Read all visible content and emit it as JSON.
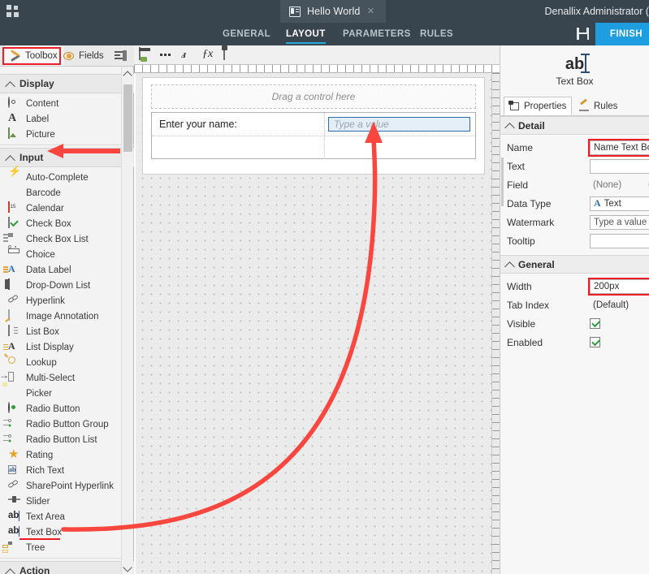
{
  "titlebar": {
    "app_menu_icon": "waffle-icon",
    "document_tab": {
      "title": "Hello World",
      "icon": "form-icon",
      "close": "×"
    },
    "user": "Denallix Administrator ("
  },
  "menubar": {
    "items": [
      {
        "label": "GENERAL",
        "active": false
      },
      {
        "label": "LAYOUT",
        "active": true
      },
      {
        "label": "PARAMETERS",
        "active": false
      },
      {
        "label": "RULES",
        "active": false
      }
    ],
    "save_icon": "save-floppy-icon",
    "finish_label": "FINISH"
  },
  "toolbox_panel": {
    "tabs": [
      {
        "label": "Toolbox",
        "icon": "wrench-icon",
        "selected": true,
        "highlighted": true
      },
      {
        "label": "Fields",
        "icon": "fields-icon",
        "selected": false
      },
      {
        "label": "",
        "icon": "list-view-icon",
        "selected": false
      }
    ],
    "sections": [
      {
        "label": "Display",
        "items": [
          {
            "label": "Content",
            "icon": "at-icon"
          },
          {
            "label": "Label",
            "icon": "letter-a-icon"
          },
          {
            "label": "Picture",
            "icon": "picture-icon"
          }
        ]
      },
      {
        "label": "Input",
        "annotated": true,
        "items": [
          {
            "label": "Auto-Complete",
            "icon": "lightning-icon"
          },
          {
            "label": "Barcode",
            "icon": "barcode-icon"
          },
          {
            "label": "Calendar",
            "icon": "calendar-icon"
          },
          {
            "label": "Check Box",
            "icon": "checkbox-icon"
          },
          {
            "label": "Check Box List",
            "icon": "checkbox-list-icon"
          },
          {
            "label": "Choice",
            "icon": "choice-icon"
          },
          {
            "label": "Data Label",
            "icon": "data-label-icon"
          },
          {
            "label": "Drop-Down List",
            "icon": "dropdown-icon"
          },
          {
            "label": "Hyperlink",
            "icon": "link-icon"
          },
          {
            "label": "Image Annotation",
            "icon": "image-annotation-icon"
          },
          {
            "label": "List Box",
            "icon": "list-box-icon"
          },
          {
            "label": "List Display",
            "icon": "list-display-icon"
          },
          {
            "label": "Lookup",
            "icon": "magnifier-icon"
          },
          {
            "label": "Multi-Select",
            "icon": "multi-select-icon"
          },
          {
            "label": "Picker",
            "icon": "picker-icon"
          },
          {
            "label": "Radio Button",
            "icon": "radio-icon"
          },
          {
            "label": "Radio Button Group",
            "icon": "radio-group-icon"
          },
          {
            "label": "Radio Button List",
            "icon": "radio-list-icon"
          },
          {
            "label": "Rating",
            "icon": "star-icon"
          },
          {
            "label": "Rich Text",
            "icon": "rich-text-icon"
          },
          {
            "label": "SharePoint Hyperlink",
            "icon": "link-icon"
          },
          {
            "label": "Slider",
            "icon": "slider-icon"
          },
          {
            "label": "Text Area",
            "icon": "ab-cursor-icon"
          },
          {
            "label": "Text Box",
            "icon": "ab-cursor-icon",
            "highlighted": true
          },
          {
            "label": "Tree",
            "icon": "tree-icon"
          }
        ]
      },
      {
        "label": "Action",
        "items": []
      }
    ]
  },
  "canvas": {
    "toolbar_icons": [
      "insert-control-icon",
      "more-options-icon",
      "cut-transition-icon",
      "function-icon",
      "paste-icon"
    ],
    "drop_zone_text": "Drag a control here",
    "table": {
      "rows": [
        {
          "left_cell": "Enter your name:",
          "right_cell_control": {
            "type": "text-box",
            "watermark": "Type a value",
            "selected": true
          }
        },
        {
          "left_cell": "",
          "right_cell_control": null
        }
      ]
    }
  },
  "properties_panel": {
    "control_icon": "ab-cursor-icon",
    "control_type": "Text Box",
    "tabs": [
      {
        "label": "Properties",
        "icon": "properties-icon",
        "selected": true
      },
      {
        "label": "Rules",
        "icon": "rules-gavel-icon",
        "selected": false
      }
    ],
    "sections": [
      {
        "label": "Detail",
        "rows": [
          {
            "label": "Name",
            "value": "Name Text Bo,",
            "kind": "text",
            "highlighted": true
          },
          {
            "label": "Text",
            "value": "",
            "kind": "text"
          },
          {
            "label": "Field",
            "value": "(None)",
            "kind": "picker"
          },
          {
            "label": "Data Type",
            "value": "Text",
            "kind": "dropdown"
          },
          {
            "label": "Watermark",
            "value": "Type a value",
            "kind": "text"
          },
          {
            "label": "Tooltip",
            "value": "",
            "kind": "text"
          }
        ]
      },
      {
        "label": "General",
        "rows": [
          {
            "label": "Width",
            "value": "200px",
            "kind": "text",
            "highlighted": true
          },
          {
            "label": "Tab Index",
            "value": "(Default)",
            "kind": "plain"
          },
          {
            "label": "Visible",
            "value": true,
            "kind": "checkbox"
          },
          {
            "label": "Enabled",
            "value": true,
            "kind": "checkbox"
          }
        ]
      }
    ]
  },
  "annotations": {
    "accent_red": "#ee1c25",
    "accent_blue": "#1e9ee0",
    "arrow_input_label": "points-left-at-input-section",
    "arrow_drag_path": "curve-from-text-box-item-to-canvas-control"
  }
}
